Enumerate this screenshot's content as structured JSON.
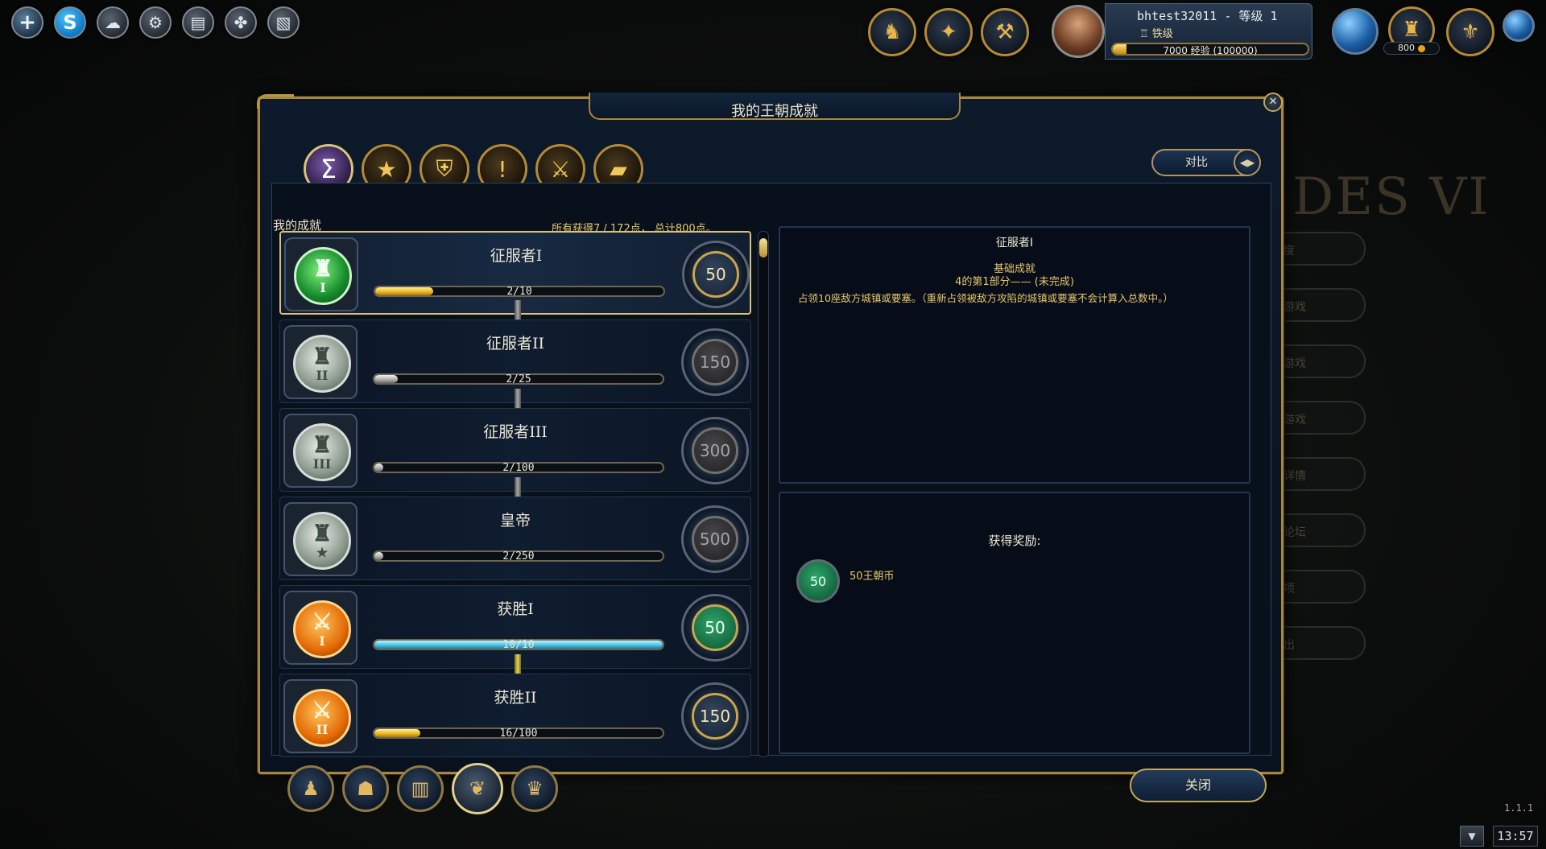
{
  "top_left_toolbar": {
    "buttons": [
      {
        "icon": "plus-icon",
        "glyph": "+"
      },
      {
        "icon": "skype-icon",
        "glyph": "S"
      },
      {
        "icon": "chat-bubbles-icon",
        "glyph": "☁"
      },
      {
        "icon": "wrench-icon",
        "glyph": "⚙"
      },
      {
        "icon": "scroll-icon",
        "glyph": "▤"
      },
      {
        "icon": "friends-icon",
        "glyph": "✤"
      },
      {
        "icon": "mail-icon",
        "glyph": "▧"
      }
    ]
  },
  "hud": {
    "player_name": "bhtest32011 - 等级 1",
    "rank": "铁级",
    "xp_text": "7000 经验 (100000)",
    "xp_fraction": 0.07,
    "coins": "800"
  },
  "dialog": {
    "title": "我的王朝成就",
    "close_glyph": "✕",
    "tabs": [
      {
        "icon": "sigma-icon",
        "glyph": "Σ",
        "active": true
      },
      {
        "icon": "star-icon",
        "glyph": "★"
      },
      {
        "icon": "helmet-icon",
        "glyph": "⛨"
      },
      {
        "icon": "exclamation-icon",
        "glyph": "!"
      },
      {
        "icon": "crossed-swords-icon",
        "glyph": "⚔"
      },
      {
        "icon": "map-icon",
        "glyph": "▰"
      }
    ],
    "compare_label": "对比",
    "compare_arrow": "◀▶",
    "section_label": "我的成就",
    "summary": "所有获得7 / 172点，  总计800点。",
    "achievements": [
      {
        "title": "征服者I",
        "count": "2/10",
        "progress": 0.2,
        "points": "50",
        "medal": "green",
        "medal_glyph": "♜",
        "medal_roman": "I",
        "bar": "gold",
        "points_state": "earned",
        "selected": true
      },
      {
        "title": "征服者II",
        "count": "2/25",
        "progress": 0.08,
        "points": "150",
        "medal": "grey",
        "medal_glyph": "♜",
        "medal_roman": "II",
        "bar": "silver",
        "points_state": "locked"
      },
      {
        "title": "征服者III",
        "count": "2/100",
        "progress": 0.02,
        "points": "300",
        "medal": "grey",
        "medal_glyph": "♜",
        "medal_roman": "III",
        "bar": "silver",
        "points_state": "locked"
      },
      {
        "title": "皇帝",
        "count": "2/250",
        "progress": 0.008,
        "points": "500",
        "medal": "grey",
        "medal_glyph": "♜",
        "medal_roman": "★",
        "bar": "silver",
        "points_state": "locked"
      },
      {
        "title": "获胜I",
        "count": "10/10",
        "progress": 1.0,
        "points": "50",
        "medal": "orange",
        "medal_glyph": "⚔",
        "medal_roman": "I",
        "bar": "cyan",
        "points_state": "claimed"
      },
      {
        "title": "获胜II",
        "count": "16/100",
        "progress": 0.16,
        "points": "150",
        "medal": "orange",
        "medal_glyph": "⚔",
        "medal_roman": "II",
        "bar": "gold",
        "points_state": "earned"
      }
    ],
    "detail": {
      "title": "征服者I",
      "type": "基础成就",
      "part": "4的第1部分—— (未完成)",
      "description": "占领10座敌方城镇或要塞。（重新占领被敌方攻陷的城镇或要塞不会计算入总数中。）"
    },
    "reward": {
      "title": "获得奖励:",
      "coin_value": "50",
      "label": "50王朝币"
    },
    "close_label": "关闭",
    "bottom_tabs": [
      {
        "icon": "hero-bust-icon",
        "glyph": "♟"
      },
      {
        "icon": "dynasty-heroes-icon",
        "glyph": "☗"
      },
      {
        "icon": "book-icon",
        "glyph": "▥"
      },
      {
        "icon": "laurel-icon",
        "glyph": "❦",
        "active": true
      },
      {
        "icon": "trophy-icon",
        "glyph": "♛"
      }
    ]
  },
  "background_menu": [
    "度",
    "游戏",
    "游戏",
    "游戏",
    "详情",
    "论坛",
    "项",
    "出"
  ],
  "background_logo": "DES VI",
  "version": "1.1.1",
  "clock": "13:57",
  "tray_glyph": "▼"
}
